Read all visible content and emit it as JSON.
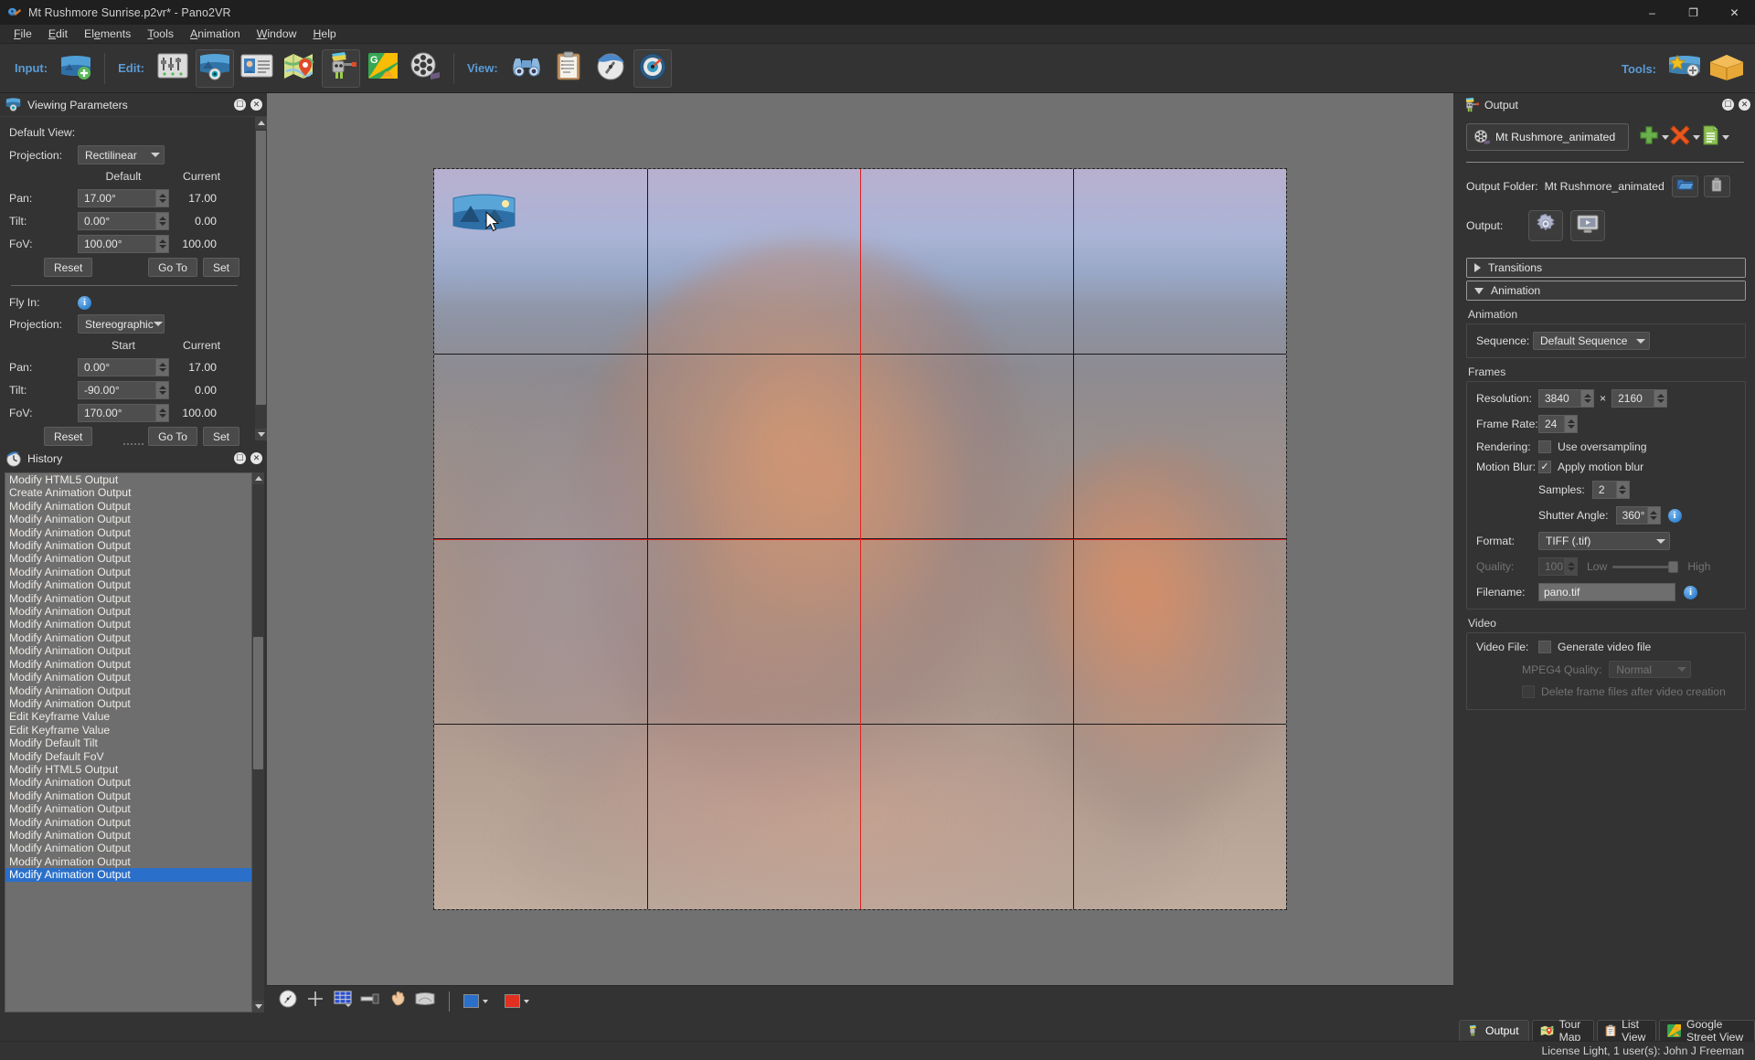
{
  "window": {
    "title": "Mt Rushmore Sunrise.p2vr* - Pano2VR",
    "app_icon": "pano2vr-app-icon",
    "minimize": "–",
    "maximize": "❐",
    "close": "✕"
  },
  "menubar": [
    {
      "label": "File",
      "mnemonic": "F"
    },
    {
      "label": "Edit",
      "mnemonic": "E"
    },
    {
      "label": "Elements",
      "mnemonic": "e"
    },
    {
      "label": "Tools",
      "mnemonic": "T"
    },
    {
      "label": "Animation",
      "mnemonic": "A"
    },
    {
      "label": "Window",
      "mnemonic": "W"
    },
    {
      "label": "Help",
      "mnemonic": "H"
    }
  ],
  "toolbar": {
    "input_label": "Input:",
    "edit_label": "Edit:",
    "view_label": "View:",
    "tools_label": "Tools:",
    "buttons": [
      {
        "name": "add-input-image",
        "icon": "panorama-add-icon"
      },
      {
        "name": "edit-settings",
        "icon": "sliders-icon"
      },
      {
        "name": "edit-viewing-parameters",
        "icon": "panorama-eye-icon"
      },
      {
        "name": "edit-user-data",
        "icon": "id-card-icon"
      },
      {
        "name": "edit-tour-map",
        "icon": "map-pin-icon"
      },
      {
        "name": "edit-output",
        "icon": "output-robot-icon"
      },
      {
        "name": "google-street-view",
        "icon": "google-maps-icon"
      },
      {
        "name": "animation-editor",
        "icon": "film-reel-icon"
      },
      {
        "name": "view-preview",
        "icon": "binoculars-icon"
      },
      {
        "name": "view-properties",
        "icon": "clipboard-icon"
      },
      {
        "name": "view-skin-editor",
        "icon": "compass-clock-icon"
      },
      {
        "name": "view-panorama-inspector",
        "icon": "gauge-icon"
      },
      {
        "name": "tools-skin",
        "icon": "star-skin-icon"
      },
      {
        "name": "tools-package",
        "icon": "package-icon"
      }
    ]
  },
  "viewing_parameters": {
    "panel_title": "Viewing Parameters",
    "panel_icon": "panorama-eye-icon",
    "default_view_label": "Default View:",
    "projection_label": "Projection:",
    "projection_value": "Rectilinear",
    "col_default": "Default",
    "col_current": "Current",
    "rows": [
      {
        "label": "Pan:",
        "value": "17.00°",
        "current": "17.00"
      },
      {
        "label": "Tilt:",
        "value": "0.00°",
        "current": "0.00"
      },
      {
        "label": "FoV:",
        "value": "100.00°",
        "current": "100.00"
      }
    ],
    "reset_label": "Reset",
    "goto_label": "Go To",
    "set_label": "Set",
    "flyin_label": "Fly In:",
    "flyin_projection_label": "Projection:",
    "flyin_projection_value": "Stereographic",
    "flyin_col_start": "Start",
    "flyin_col_current": "Current",
    "flyin_rows": [
      {
        "label": "Pan:",
        "value": "0.00°",
        "current": "17.00"
      },
      {
        "label": "Tilt:",
        "value": "-90.00°",
        "current": "0.00"
      },
      {
        "label": "FoV:",
        "value": "170.00°",
        "current": "100.00"
      }
    ],
    "flyin_reset_label": "Reset",
    "flyin_goto_label": "Go To",
    "flyin_set_label": "Set"
  },
  "history": {
    "panel_title": "History",
    "panel_icon": "history-clock-icon",
    "items": [
      "Modify HTML5 Output",
      "Create Animation Output",
      "Modify Animation Output",
      "Modify Animation Output",
      "Modify Animation Output",
      "Modify Animation Output",
      "Modify Animation Output",
      "Modify Animation Output",
      "Modify Animation Output",
      "Modify Animation Output",
      "Modify Animation Output",
      "Modify Animation Output",
      "Modify Animation Output",
      "Modify Animation Output",
      "Modify Animation Output",
      "Modify Animation Output",
      "Modify Animation Output",
      "Modify Animation Output",
      "Edit Keyframe Value",
      "Edit Keyframe Value",
      "Modify Default Tilt",
      "Modify Default FoV",
      "Modify HTML5 Output",
      "Modify Animation Output",
      "Modify Animation Output",
      "Modify Animation Output",
      "Modify Animation Output",
      "Modify Animation Output",
      "Modify Animation Output",
      "Modify Animation Output",
      "Modify Animation Output"
    ],
    "selected_index": 30
  },
  "viewer": {
    "node_marker_icon": "panorama-node-icon",
    "cursor_icon": "mouse-pointer-icon",
    "toolbar": [
      {
        "name": "compass-tool",
        "icon": "compass-icon"
      },
      {
        "name": "crosshair-tool",
        "icon": "crosshair-icon"
      },
      {
        "name": "grid-tool",
        "icon": "grid-icon"
      },
      {
        "name": "level-tool",
        "icon": "level-icon"
      },
      {
        "name": "hand-tool",
        "icon": "hand-icon"
      },
      {
        "name": "patch-tool",
        "icon": "patch-icon"
      }
    ],
    "grid_color": "#2a4fd0",
    "crosshair_color": "#e02020",
    "swatch_outline_color": "#2a6fc9",
    "swatch_fill_color": "#e03020"
  },
  "output": {
    "panel_title": "Output",
    "panel_icon": "output-robot-icon",
    "preset_value": "Mt Rushmore_animated",
    "preset_icon": "film-reel-icon",
    "add_icon": "plus-icon",
    "remove_icon": "cross-icon",
    "template_icon": "document-list-icon",
    "output_folder_label": "Output Folder:",
    "output_folder_value": "Mt Rushmore_animated",
    "folder_icon": "open-folder-icon",
    "trash_icon": "trash-icon",
    "output_label": "Output:",
    "gear_icon": "gear-icon",
    "preview_icon": "monitor-play-icon",
    "transitions_label": "Transitions",
    "animation_label": "Animation",
    "animation_group_title": "Animation",
    "sequence_label": "Sequence:",
    "sequence_value": "Default Sequence",
    "frames_group_title": "Frames",
    "resolution_label": "Resolution:",
    "resolution_width": "3840",
    "resolution_sep": "×",
    "resolution_height": "2160",
    "framerate_label": "Frame Rate:",
    "framerate_value": "24",
    "rendering_label": "Rendering:",
    "oversampling_label": "Use oversampling",
    "oversampling_checked": false,
    "motion_blur_label": "Motion Blur:",
    "apply_motion_blur_label": "Apply motion blur",
    "apply_motion_blur_checked": true,
    "samples_label": "Samples:",
    "samples_value": "2",
    "shutter_angle_label": "Shutter Angle:",
    "shutter_angle_value": "360°",
    "format_label": "Format:",
    "format_value": "TIFF (.tif)",
    "quality_label": "Quality:",
    "quality_value": "100",
    "quality_low": "Low",
    "quality_high": "High",
    "filename_label": "Filename:",
    "filename_value": "pano.tif",
    "video_group_title": "Video",
    "video_file_label": "Video File:",
    "generate_video_label": "Generate video file",
    "generate_video_checked": false,
    "mpeg4_quality_label": "MPEG4 Quality:",
    "mpeg4_quality_value": "Normal",
    "delete_frames_label": "Delete frame files after video creation",
    "delete_frames_checked": false
  },
  "tabs": [
    {
      "label": "Output",
      "icon": "output-robot-icon",
      "active": true
    },
    {
      "label": "Tour Map",
      "icon": "map-pin-icon",
      "active": false
    },
    {
      "label": "List View",
      "icon": "clipboard-icon",
      "active": false
    },
    {
      "label": "Google Street View",
      "icon": "google-maps-icon",
      "active": false
    }
  ],
  "statusbar": {
    "text": "License Light, 1 user(s): John J Freeman"
  }
}
